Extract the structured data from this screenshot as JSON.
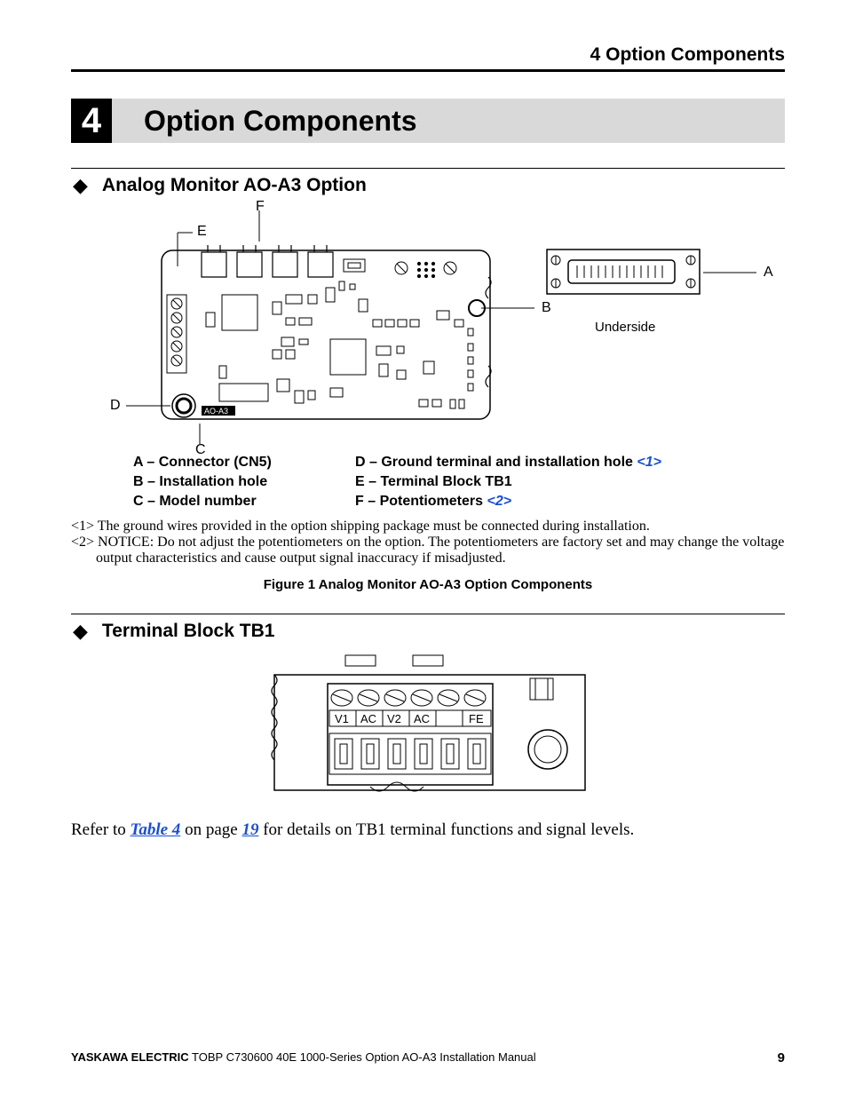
{
  "running_header": "4  Option Components",
  "chapter": {
    "number": "4",
    "title": "Option Components"
  },
  "section1": {
    "title": "Analog Monitor AO-A3 Option"
  },
  "fig_labels": {
    "A": "A",
    "B": "B",
    "C": "C",
    "D": "D",
    "E": "E",
    "F": "F",
    "underside": "Underside",
    "model": "AO-A3"
  },
  "legend": {
    "A": "A  –  Connector (CN5)",
    "B": "B  –  Installation hole",
    "C": "C  –  Model number",
    "D": "D  –  Ground terminal and installation hole ",
    "D_ref": "<1>",
    "E": "E  –  Terminal Block TB1",
    "F": "F  –  Potentiometers ",
    "F_ref": "<2>"
  },
  "notes": {
    "n1": "<1> The ground wires provided in the option shipping package must be connected during installation.",
    "n2": "<2> NOTICE: Do not adjust the potentiometers on the option. The potentiometers are factory set and may change the voltage output characteristics and cause output signal inaccuracy if misadjusted."
  },
  "figure_caption": "Figure 1  Analog Monitor AO-A3 Option Components",
  "section2": {
    "title": "Terminal Block TB1"
  },
  "tb1_labels": [
    "V1",
    "AC",
    "V2",
    "AC",
    "",
    "FE"
  ],
  "body_text": {
    "pre": "Refer to ",
    "link1": "Table 4",
    "mid": " on page ",
    "link2": "19",
    "post": " for details on TB1 terminal functions and signal levels."
  },
  "footer": {
    "brand": "YASKAWA ELECTRIC",
    "doc": " TOBP C730600 40E 1000-Series Option AO-A3 Installation Manual",
    "page": "9"
  }
}
